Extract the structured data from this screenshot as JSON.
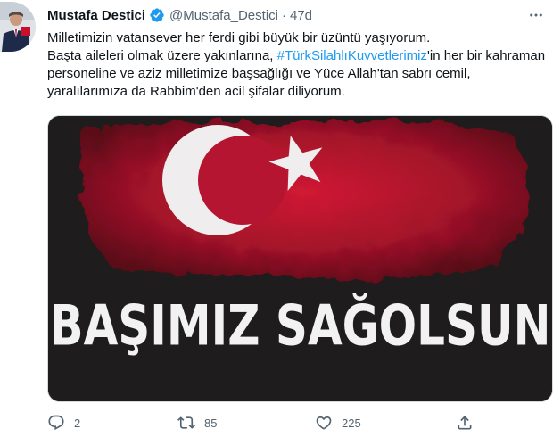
{
  "author": {
    "name": "Mustafa Destici",
    "handle": "@Mustafa_Destici",
    "separator": "·",
    "time": "47d",
    "verified_icon": "verified-badge-icon"
  },
  "tweet": {
    "line1": "Milletimizin vatansever her ferdi gibi büyük bir üzüntü yaşıyorum.",
    "line2_before": "Başta aileleri olmak üzere yakınlarına, ",
    "hashtag": "#TürkSilahlıKuvvetlerimiz",
    "line2_after": "'in her bir kahraman personeline ve aziz milletimize başsağlığı ve Yüce Allah'tan sabrı cemil, yaralılarımıza da Rabbim'den acil şifalar diliyorum."
  },
  "media": {
    "caption": "BAŞIMIZ SAĞOLSUN",
    "flag_color": "#c8102e",
    "background_color": "#1f1c1d"
  },
  "actions": {
    "reply_count": "2",
    "retweet_count": "85",
    "like_count": "225"
  },
  "colors": {
    "accent": "#1d9bf0",
    "muted": "#536471"
  }
}
